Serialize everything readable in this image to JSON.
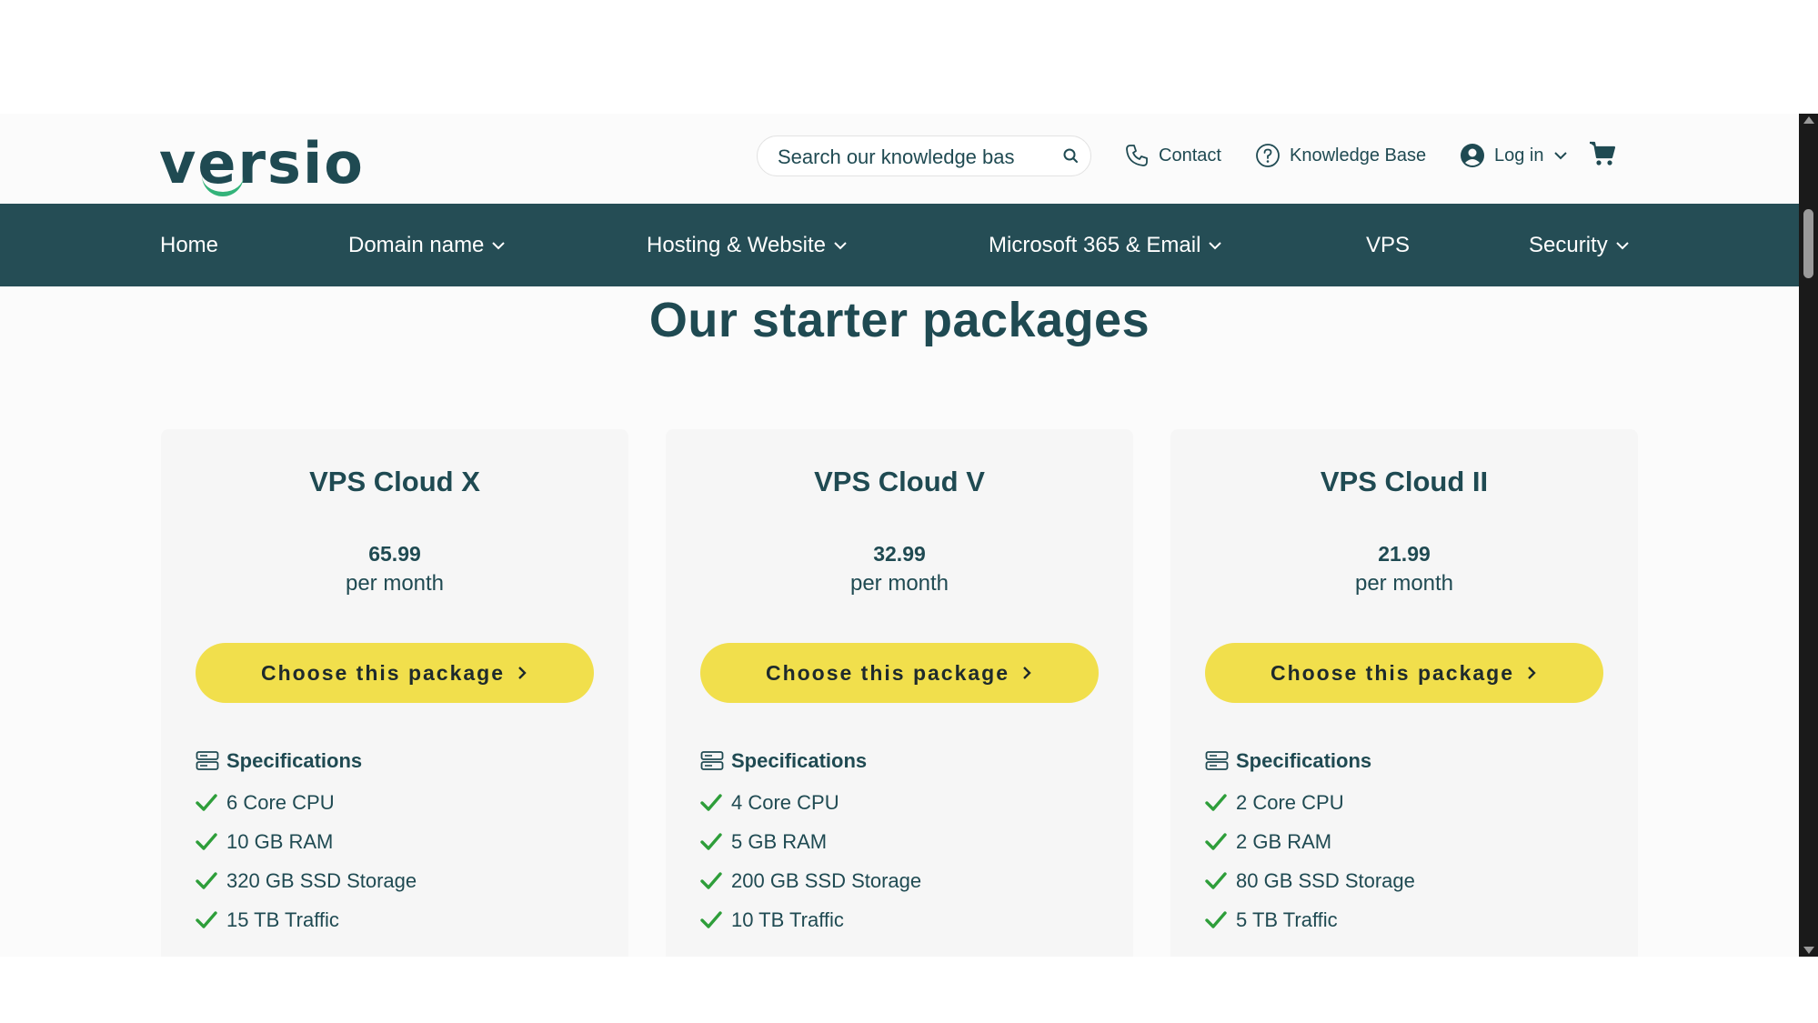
{
  "brand": {
    "logo_text": "versio"
  },
  "header": {
    "search_placeholder": "Search our knowledge bas",
    "contact_label": "Contact",
    "knowledge_base_label": "Knowledge Base",
    "login_label": "Log in"
  },
  "nav": {
    "items": [
      {
        "label": "Home",
        "dropdown": false
      },
      {
        "label": "Domain name",
        "dropdown": true
      },
      {
        "label": "Hosting & Website",
        "dropdown": true
      },
      {
        "label": "Microsoft 365 & Email",
        "dropdown": true
      },
      {
        "label": "VPS",
        "dropdown": false
      },
      {
        "label": "Security",
        "dropdown": true
      }
    ]
  },
  "main": {
    "heading": "Our starter packages",
    "packages": [
      {
        "title": "VPS Cloud X",
        "price": "65.99",
        "period": "per month",
        "button_label": "Choose this package",
        "spec_heading": "Specifications",
        "specs": [
          "6 Core CPU",
          "10 GB RAM",
          "320 GB SSD Storage",
          "15 TB Traffic"
        ]
      },
      {
        "title": "VPS Cloud V",
        "price": "32.99",
        "period": "per month",
        "button_label": "Choose this package",
        "spec_heading": "Specifications",
        "specs": [
          "4 Core CPU",
          "5 GB RAM",
          "200 GB SSD Storage",
          "10 TB Traffic"
        ]
      },
      {
        "title": "VPS Cloud II",
        "price": "21.99",
        "period": "per month",
        "button_label": "Choose this package",
        "spec_heading": "Specifications",
        "specs": [
          "2 Core CPU",
          "2 GB RAM",
          "80 GB SSD Storage",
          "5 TB Traffic"
        ]
      }
    ]
  },
  "colors": {
    "primary": "#254d55",
    "text": "#1f4a52",
    "accent_yellow": "#f1df4c",
    "check_green": "#2e9e3a",
    "logo_swoosh": "#33b37a"
  }
}
